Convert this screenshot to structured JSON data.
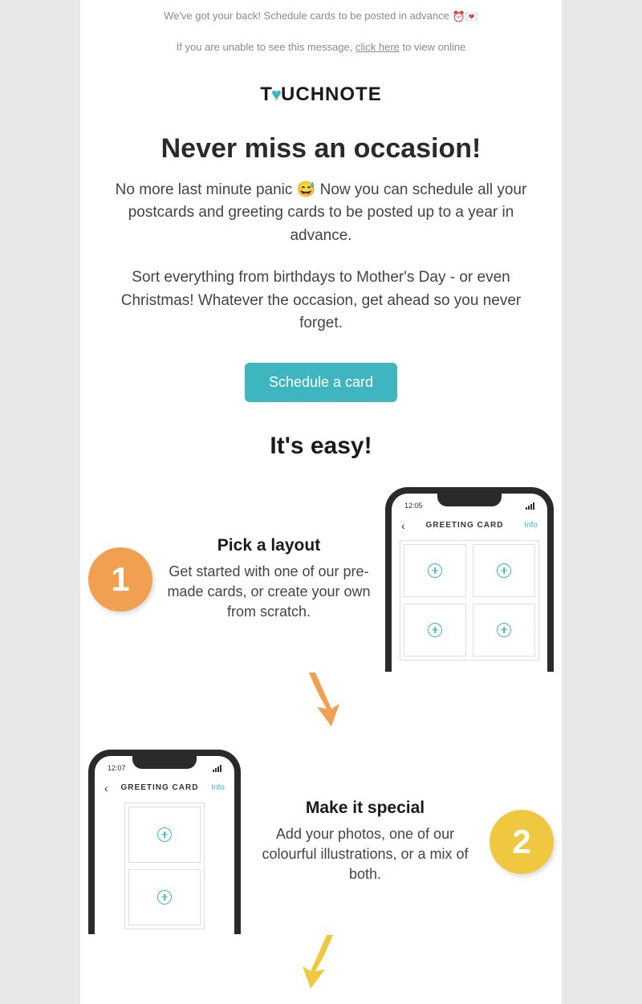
{
  "preheader": {
    "text": "We've got your back! Schedule cards to be posted in advance ",
    "emoji": "⏰💌"
  },
  "viewOnline": {
    "prefix": "If you are unable to see this message, ",
    "linkText": "click here",
    "suffix": " to view online"
  },
  "logo": {
    "part1": "T",
    "heart": "♥",
    "part2": "UCHNOTE"
  },
  "hero": {
    "title": "Never miss an occasion!",
    "para1a": "No more last minute panic ",
    "para1emoji": "😅",
    "para1b": " Now you can schedule all your postcards and greeting cards to be posted up to a year in advance.",
    "para2": "Sort everything from birthdays to Mother's Day - or even Christmas! Whatever the occasion, get ahead so you never forget."
  },
  "cta": {
    "label": "Schedule a card"
  },
  "easy": {
    "title": "It's easy!"
  },
  "steps": [
    {
      "num": "1",
      "title": "Pick a layout",
      "desc": "Get started with one of our pre-made cards, or create your own from scratch."
    },
    {
      "num": "2",
      "title": "Make it special",
      "desc": "Add your photos, one of our colourful illustrations, or a mix of both."
    }
  ],
  "phone": {
    "time1": "12:05",
    "time2": "12:07",
    "headerTitle": "GREETING CARD",
    "info": "Info",
    "back": "‹"
  },
  "colors": {
    "teal": "#3fb5bf",
    "orange": "#f0a050",
    "yellow": "#f0c840"
  }
}
